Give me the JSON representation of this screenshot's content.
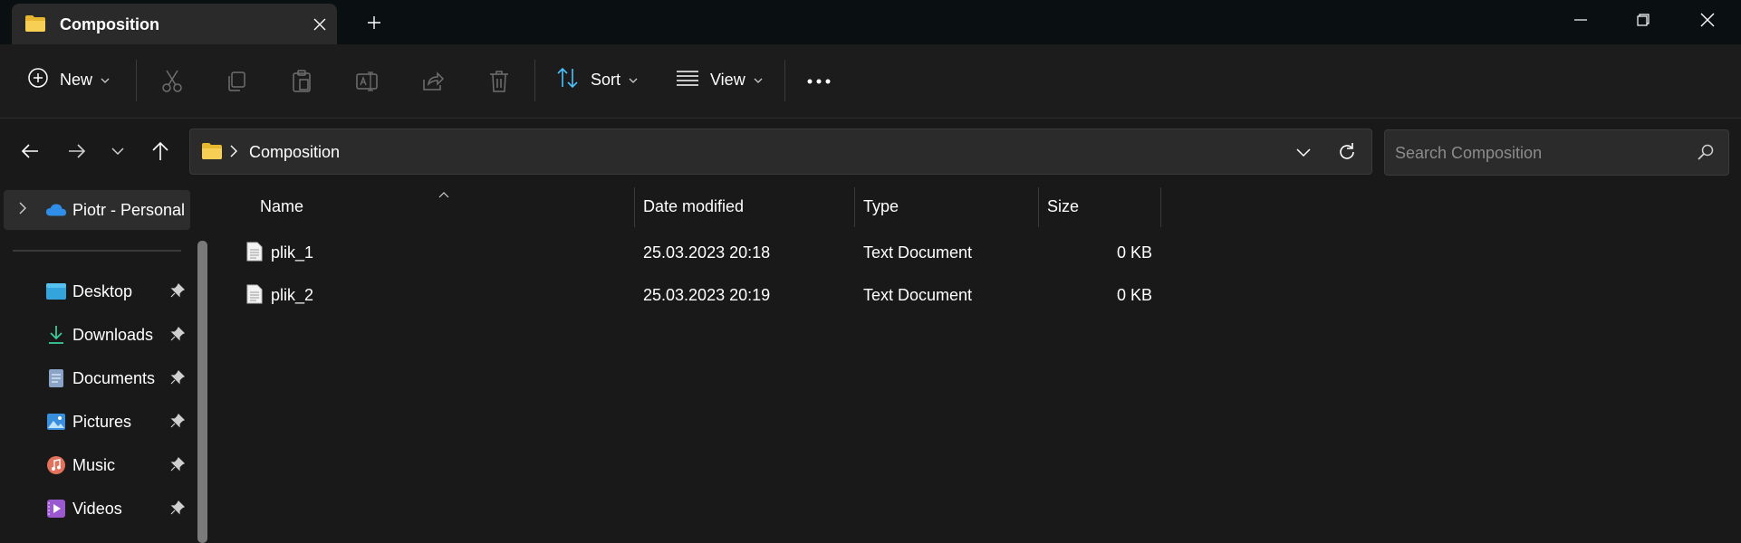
{
  "window": {
    "tab_title": "Composition",
    "tab_icon": "folder-icon",
    "new_tab_icon": "plus-icon",
    "controls": [
      "minimize-icon",
      "restore-icon",
      "close-icon"
    ]
  },
  "toolbar": {
    "new_label": "New",
    "sort_label": "Sort",
    "view_label": "View",
    "icons": [
      "cut-icon",
      "copy-icon",
      "paste-icon",
      "rename-icon",
      "share-icon",
      "delete-icon",
      "more-icon"
    ]
  },
  "address": {
    "path": "Composition",
    "search_placeholder": "Search Composition"
  },
  "sidebar": {
    "account": "Piotr - Personal",
    "items": [
      {
        "label": "Desktop",
        "icon": "desktop-icon"
      },
      {
        "label": "Downloads",
        "icon": "download-icon"
      },
      {
        "label": "Documents",
        "icon": "documents-icon"
      },
      {
        "label": "Pictures",
        "icon": "pictures-icon"
      },
      {
        "label": "Music",
        "icon": "music-icon"
      },
      {
        "label": "Videos",
        "icon": "videos-icon"
      }
    ]
  },
  "columns": {
    "name": "Name",
    "date": "Date modified",
    "type": "Type",
    "size": "Size"
  },
  "files": [
    {
      "name": "plik_1",
      "date": "25.03.2023 20:18",
      "type": "Text Document",
      "size": "0 KB"
    },
    {
      "name": "plik_2",
      "date": "25.03.2023 20:19",
      "type": "Text Document",
      "size": "0 KB"
    }
  ],
  "colors": {
    "background": "#191919",
    "titlebar": "#0a0f12",
    "accent": "#4cc2ff",
    "folder": "#f2c744"
  }
}
